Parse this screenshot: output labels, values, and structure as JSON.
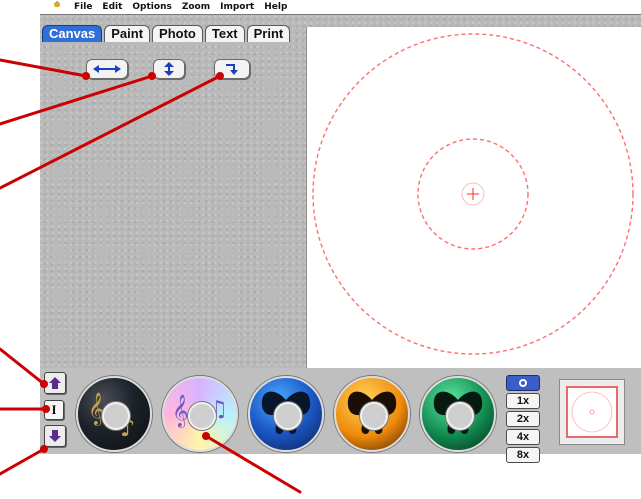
{
  "menu": {
    "apple_icon": "apple-icon",
    "items": [
      "File",
      "Edit",
      "Options",
      "Zoom",
      "Import",
      "Help"
    ]
  },
  "tabs": [
    {
      "label": "Canvas",
      "active": true
    },
    {
      "label": "Paint",
      "active": false
    },
    {
      "label": "Photo",
      "active": false
    },
    {
      "label": "Text",
      "active": false
    },
    {
      "label": "Print",
      "active": false
    }
  ],
  "toolbar": {
    "buttons": [
      {
        "name": "flip-horizontal-button",
        "icon": "arrow-left-right-icon"
      },
      {
        "name": "flip-vertical-button",
        "icon": "arrow-up-down-icon"
      },
      {
        "name": "rotate-button",
        "icon": "rotate-arrow-icon"
      }
    ]
  },
  "canvas": {
    "guide_color": "#ff6d6d",
    "center_mark": "+"
  },
  "side_controls": {
    "up_icon": "up-arrow-icon",
    "middle_label": "I",
    "down_icon": "down-arrow-icon"
  },
  "thumbnails": [
    {
      "name": "disc-thumbnail-music-dark",
      "style": "dark-music-notes"
    },
    {
      "name": "disc-thumbnail-music-pastel",
      "style": "pastel-music-notes"
    },
    {
      "name": "disc-thumbnail-butterfly-blue",
      "style": "blue-butterfly"
    },
    {
      "name": "disc-thumbnail-butterfly-orange",
      "style": "orange-butterfly"
    },
    {
      "name": "disc-thumbnail-butterfly-green",
      "style": "green-butterfly"
    }
  ],
  "zoom": {
    "buttons": [
      "1x",
      "2x",
      "4x",
      "8x"
    ],
    "icon": "disc-view-icon"
  },
  "colors": {
    "tab_active": "#2f6fd6",
    "callout": "#cc0000"
  }
}
